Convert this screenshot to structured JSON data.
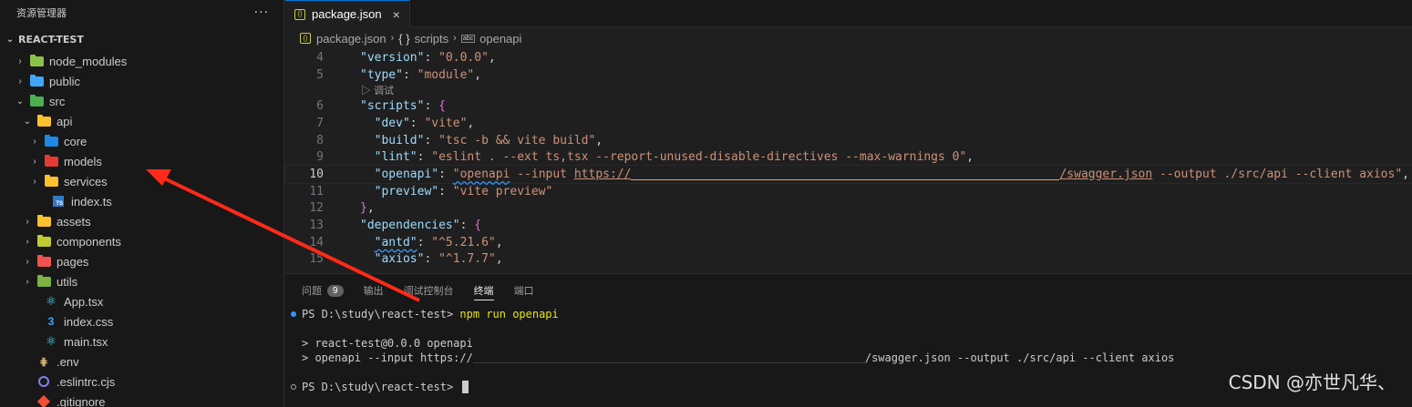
{
  "sidebar": {
    "title": "资源管理器",
    "more": "···",
    "root": "REACT-TEST",
    "items": [
      {
        "label": "node_modules",
        "chev": "›",
        "icon": "folder-green-icon",
        "color": "#8bc34a"
      },
      {
        "label": "public",
        "chev": "›",
        "icon": "folder-blue-icon",
        "color": "#42a5f5"
      },
      {
        "label": "src",
        "chev": "⌄",
        "icon": "folder-src-icon",
        "color": "#4caf50"
      },
      {
        "label": "api",
        "chev": "⌄",
        "icon": "folder-api-icon",
        "color": "#fbc02d"
      },
      {
        "label": "core",
        "chev": "›",
        "icon": "folder-core-icon",
        "color": "#1e88e5"
      },
      {
        "label": "models",
        "chev": "›",
        "icon": "folder-models-icon",
        "color": "#e53935"
      },
      {
        "label": "services",
        "chev": "›",
        "icon": "folder-services-icon",
        "color": "#fbc02d"
      },
      {
        "label": "index.ts",
        "chev": "",
        "icon": "typescript-file-icon",
        "color": "#3178c6"
      },
      {
        "label": "assets",
        "chev": "›",
        "icon": "folder-assets-icon",
        "color": "#fbc02d"
      },
      {
        "label": "components",
        "chev": "›",
        "icon": "folder-components-icon",
        "color": "#c0ca33"
      },
      {
        "label": "pages",
        "chev": "›",
        "icon": "folder-pages-icon",
        "color": "#ef5350"
      },
      {
        "label": "utils",
        "chev": "›",
        "icon": "folder-utils-icon",
        "color": "#7cb342"
      },
      {
        "label": "App.tsx",
        "chev": "",
        "icon": "react-file-icon",
        "color": "#61dafb"
      },
      {
        "label": "index.css",
        "chev": "",
        "icon": "css-file-icon",
        "color": "#42a5f5"
      },
      {
        "label": "main.tsx",
        "chev": "",
        "icon": "react-file-icon",
        "color": "#61dafb"
      },
      {
        "label": ".env",
        "chev": "",
        "icon": "env-file-icon",
        "color": "#e5c07b"
      },
      {
        "label": ".eslintrc.cjs",
        "chev": "",
        "icon": "eslint-file-icon",
        "color": "#8080f2"
      },
      {
        "label": ".gitignore",
        "chev": "",
        "icon": "git-file-icon",
        "color": "#f05033"
      }
    ]
  },
  "editor": {
    "tab": {
      "label": "package.json",
      "icon_text": "{}",
      "close": "×"
    },
    "breadcrumb": {
      "file": "package.json",
      "scripts": "scripts",
      "braces": "{ }",
      "key": "openapi",
      "abc": "abc",
      "sep": "›"
    },
    "codelens": "▷ 调试",
    "lines": {
      "l4": {
        "n": "4",
        "k": "\"version\"",
        "v": "\"0.0.0\""
      },
      "l5": {
        "n": "5",
        "k": "\"type\"",
        "v": "\"module\""
      },
      "l6": {
        "n": "6",
        "k": "\"scripts\""
      },
      "l7": {
        "n": "7",
        "k": "\"dev\"",
        "v": "\"vite\""
      },
      "l8": {
        "n": "8",
        "k": "\"build\"",
        "v": "\"tsc -b && vite build\""
      },
      "l9": {
        "n": "9",
        "k": "\"lint\"",
        "v": "\"eslint . --ext ts,tsx --report-unused-disable-directives --max-warnings 0\""
      },
      "l10": {
        "n": "10",
        "k": "\"openapi\"",
        "v1": "\"openapi",
        "v2": " --input ",
        "v3": "https://",
        "v4": "/swagger.json",
        "v5": " --output ./src/api --client axios\""
      },
      "l11": {
        "n": "11",
        "k": "\"preview\"",
        "v": "\"vite preview\""
      },
      "l12": {
        "n": "12"
      },
      "l13": {
        "n": "13",
        "k": "\"dependencies\""
      },
      "l14": {
        "n": "14",
        "k": "\"antd\"",
        "v": "\"^5.21.6\""
      },
      "l15": {
        "n": "15",
        "k": "\"axios\"",
        "v": "\"^1.7.7\""
      }
    }
  },
  "panel": {
    "tabs": [
      {
        "label": "问题",
        "badge": "9"
      },
      {
        "label": "输出"
      },
      {
        "label": "调试控制台"
      },
      {
        "label": "终端"
      },
      {
        "label": "端口"
      }
    ],
    "terminal": {
      "prompt1": "PS D:\\study\\react-test> ",
      "cmd1": "npm run openapi",
      "out1": "> react-test@0.0.0 openapi",
      "out2a": "> openapi --input https://",
      "out2b": "/swagger.json --output ./src/api --client axios",
      "prompt2": "PS D:\\study\\react-test> "
    }
  },
  "watermark": "CSDN @亦世凡华、",
  "colors": {
    "arrow": "#ff2a1a",
    "accent": "#0078d4"
  }
}
